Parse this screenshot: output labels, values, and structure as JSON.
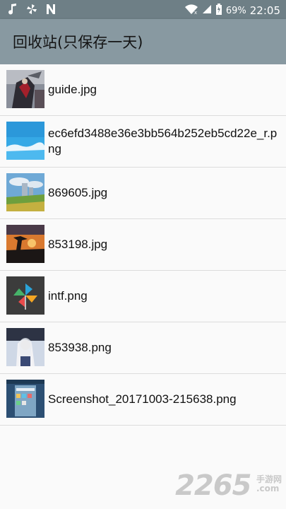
{
  "status_bar": {
    "battery": "69%",
    "time": "22:05",
    "icons": [
      "music-note-icon",
      "fan-icon",
      "n-icon",
      "wifi-icon",
      "signal-icon",
      "battery-icon"
    ]
  },
  "app_bar": {
    "title": "回收站(只保存一天)"
  },
  "files": [
    {
      "name": "guide.jpg",
      "thumb": "thumb-warrior"
    },
    {
      "name": "ec6efd3488e36e3bb564b252eb5cd22e_r.png",
      "thumb": "thumb-sky"
    },
    {
      "name": "869605.jpg",
      "thumb": "thumb-castle-field"
    },
    {
      "name": "853198.jpg",
      "thumb": "thumb-sunset-tree"
    },
    {
      "name": "intf.png",
      "thumb": "thumb-pinwheel"
    },
    {
      "name": "853938.png",
      "thumb": "thumb-anime-girl"
    },
    {
      "name": "Screenshot_20171003-215638.png",
      "thumb": "thumb-screenshot"
    }
  ],
  "watermark": {
    "number": "2265",
    "cn": "手游网",
    "domain": ".com"
  }
}
